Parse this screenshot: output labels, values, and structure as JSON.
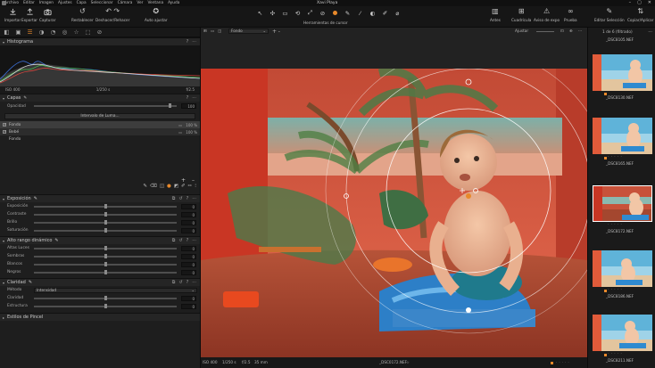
{
  "menu": {
    "items": [
      "Archivo",
      "Editar",
      "Imagen",
      "Ajustes",
      "Capa",
      "Seleccionar",
      "Cámara",
      "Ver",
      "Ventana",
      "Ayuda"
    ],
    "window_title": "Xavi Playa",
    "controls": [
      "–",
      "▢",
      "✕"
    ]
  },
  "toolbar": {
    "left_buttons": [
      {
        "icon": "import-icon",
        "label": "Importar"
      },
      {
        "icon": "export-icon",
        "label": "Exportar"
      },
      {
        "icon": "capture-icon",
        "label": "Capturar"
      }
    ],
    "undo_buttons": [
      {
        "icon": "reset-icon",
        "label": "Restablecer"
      },
      {
        "icon": "undo-icon",
        "label": "Deshacer/Rehacer"
      }
    ],
    "autoadjust": {
      "icon": "auto-adjust-icon",
      "label": "Auto ajustar"
    },
    "cursor_tools_label": "Herramientas de cursor",
    "cursor_tool_icons": [
      "↖",
      "✣",
      "▭",
      "⟲",
      "⤢",
      "⊘",
      "●",
      "✎",
      "⁄",
      "◐",
      "✐",
      "⌀"
    ],
    "right_buttons": [
      {
        "icon": "before-icon",
        "label": "Antes"
      },
      {
        "icon": "grid-icon",
        "label": "Cuadrícula"
      },
      {
        "icon": "exposure-warning-icon",
        "label": "Aviso de expo"
      },
      {
        "icon": "proof-icon",
        "label": "Prueba"
      },
      {
        "icon": "edit-selection-icon",
        "label": "Editar Selección"
      },
      {
        "icon": "copy-apply-icon",
        "label": "Copiar/Aplicar"
      }
    ]
  },
  "left_panel": {
    "tab_icons": [
      "◧",
      "▣",
      "☰",
      "◑",
      "◔",
      "◎",
      "☆",
      "⬚",
      "⊘"
    ],
    "histogram": {
      "title": "Histograma",
      "iso": "ISO 400",
      "shutter": "1/250 s",
      "aperture": "f/2.5"
    },
    "layers": {
      "title": "Capas",
      "opacity_label": "Opacidad",
      "opacity_value": "100",
      "opacity_level": 0.95,
      "luma_button": "Intervalo de Luma...",
      "rows": [
        {
          "name": "Fondo",
          "pct": "100 %",
          "checked": "✓"
        },
        {
          "name": "Bebé",
          "pct": "100 %",
          "checked": "✓"
        },
        {
          "name": "Fondo",
          "pct": "",
          "checked": ""
        }
      ]
    },
    "exposure": {
      "title": "Exposición",
      "sliders": [
        {
          "label": "Exposición",
          "value": "0",
          "level": 0.5
        },
        {
          "label": "Contraste",
          "value": "0",
          "level": 0.5
        },
        {
          "label": "Brillo",
          "value": "0",
          "level": 0.5
        },
        {
          "label": "Saturación",
          "value": "0",
          "level": 0.5
        }
      ]
    },
    "hdr": {
      "title": "Alto rango dinámico",
      "sliders": [
        {
          "label": "Altas Luces",
          "value": "0",
          "level": 0.5
        },
        {
          "label": "Sombras",
          "value": "0",
          "level": 0.5
        },
        {
          "label": "Blancos",
          "value": "0",
          "level": 0.5
        },
        {
          "label": "Negros",
          "value": "0",
          "level": 0.5
        }
      ]
    },
    "clarity": {
      "title": "Claridad",
      "method_label": "Método",
      "method_value": "Intensidad",
      "sliders": [
        {
          "label": "Claridad",
          "value": "0",
          "level": 0.5
        },
        {
          "label": "Estructura",
          "value": "0",
          "level": 0.5
        }
      ]
    },
    "brush_styles": {
      "title": "Estilos de Pincel"
    }
  },
  "viewer": {
    "layer_select": "Fondo",
    "add": "+",
    "adjust_label": "Ajustar",
    "status": {
      "iso": "ISO 400",
      "shutter": "1/250 s",
      "aperture": "f/2.5",
      "focal": "35 mm",
      "filename": "_DSC0172.NEF",
      "star": "☆"
    }
  },
  "filmstrip": {
    "count": "1 de 6 (filtrado)",
    "top_caption": "_DSC8105.NEF",
    "items": [
      {
        "caption": "_DSC8130.NEF",
        "selected": false
      },
      {
        "caption": "_DSC8165.NEF",
        "selected": false
      },
      {
        "caption": "_DSC8172.NEF",
        "selected": true
      },
      {
        "caption": "_DSC8186.NEF",
        "selected": false
      },
      {
        "caption": "_DSC8211.NEF",
        "selected": false
      }
    ]
  },
  "colors": {
    "accent": "#e8892b",
    "panel": "#1e1e1e",
    "bg": "#222222"
  }
}
